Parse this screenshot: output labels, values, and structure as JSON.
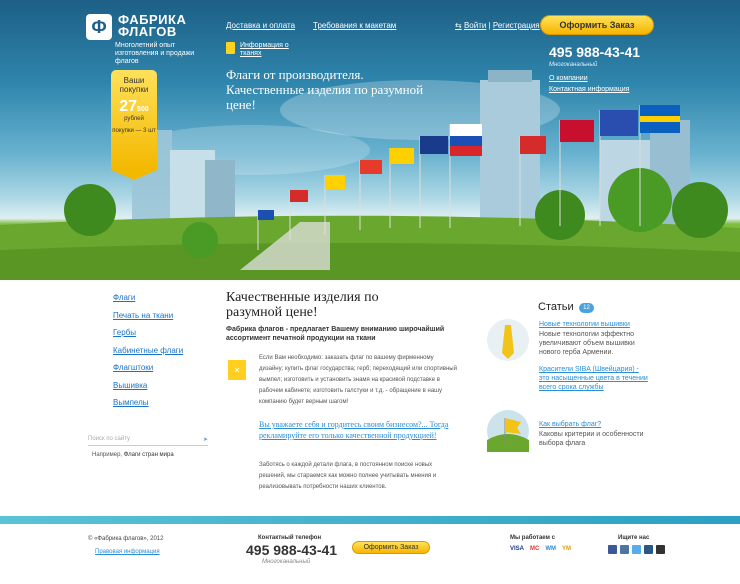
{
  "header": {
    "logo_mark": "Ф",
    "logo_title_1": "ФАБРИКА",
    "logo_title_2": "ФЛАГОВ",
    "logo_tagline": "Многолетний опыт изготовления и продажи флагов",
    "nav": [
      "Доставка и оплата",
      "Требования к макетам"
    ],
    "login": "Войти",
    "register": "Регистрация",
    "order_button": "Оформить Заказ",
    "phone": "495 988-43-41",
    "phone_note": "Многоканальный",
    "about_link": "О компании",
    "contact_link": "Контактная информация",
    "info_link": "Информация о тканях",
    "slogan": "Флаги от производителя. Качественные изделия по разумной цене!"
  },
  "cart": {
    "label": "Ваши покупки",
    "amount": "27",
    "amount_small": "500",
    "currency": "рублей",
    "items": "покупки — 3 шт"
  },
  "sidebar": {
    "items": [
      "Флаги",
      "Печать на ткани",
      "Гербы",
      "Кабинетные флаги",
      "Флагштоки",
      "Вышивка",
      "Вымпелы"
    ],
    "search_placeholder": "Поиск по сайту",
    "example_label": "Например,",
    "example_link": "Флаги стран мира"
  },
  "main": {
    "title": "Качественные изделия по разумной цене!",
    "intro": "Фабрика флагов - предлагает Вашему вниманию широчайший ассортимент печатной продукции на ткани",
    "paragraph1": "Если Вам необходимо: заказать флаг по вашему фирменному дизайну; купить флаг государства; герб; переходящий или спортивный вымпел; изготовить и установить знамя на красивой подставке в рабочем кабинете; изготовить галстуки и т.д. - обращение в нашу компанию будет верным шагом!",
    "quote": "Вы уважаете себя и гордитесь своим бизнесом?... Тогда рекламируйте его только качественной продукцией!",
    "paragraph2": "Заботясь о каждой детали флага, в постоянном поиске новых решений, мы стараемся как можно полнее учитывать мнения и реализовывать потребности наших клиентов."
  },
  "articles": {
    "title": "Статьи",
    "count": "12",
    "items": [
      {
        "link": "Новые технологии вышивки",
        "text": "Новые технологии эффектно увеличивают объем вышивки нового герба Армении.",
        "extra": "Красители SIBA (Швейцария) - это насыщенные цвета в течении всего срока службы"
      },
      {
        "link": "Как выбрать флаг?",
        "text": "Каковы критерии и особенности выбора флага"
      }
    ]
  },
  "footer": {
    "copyright": "© «Фабрика флагов», 2012",
    "legal": "Правовая информация",
    "phone_label": "Контактный телефон",
    "phone": "495 988-43-41",
    "phone_note": "Многоканальный",
    "order_button": "Оформить Заказ",
    "work_with": "Мы работаем с",
    "payments": [
      "VISA",
      "MC",
      "WM",
      "YM"
    ],
    "find_us": "Ищите нас"
  },
  "colors": {
    "accent": "#f7b500",
    "link": "#1a73c8",
    "sky": "#1d5f86",
    "grass": "#6aa72f"
  }
}
